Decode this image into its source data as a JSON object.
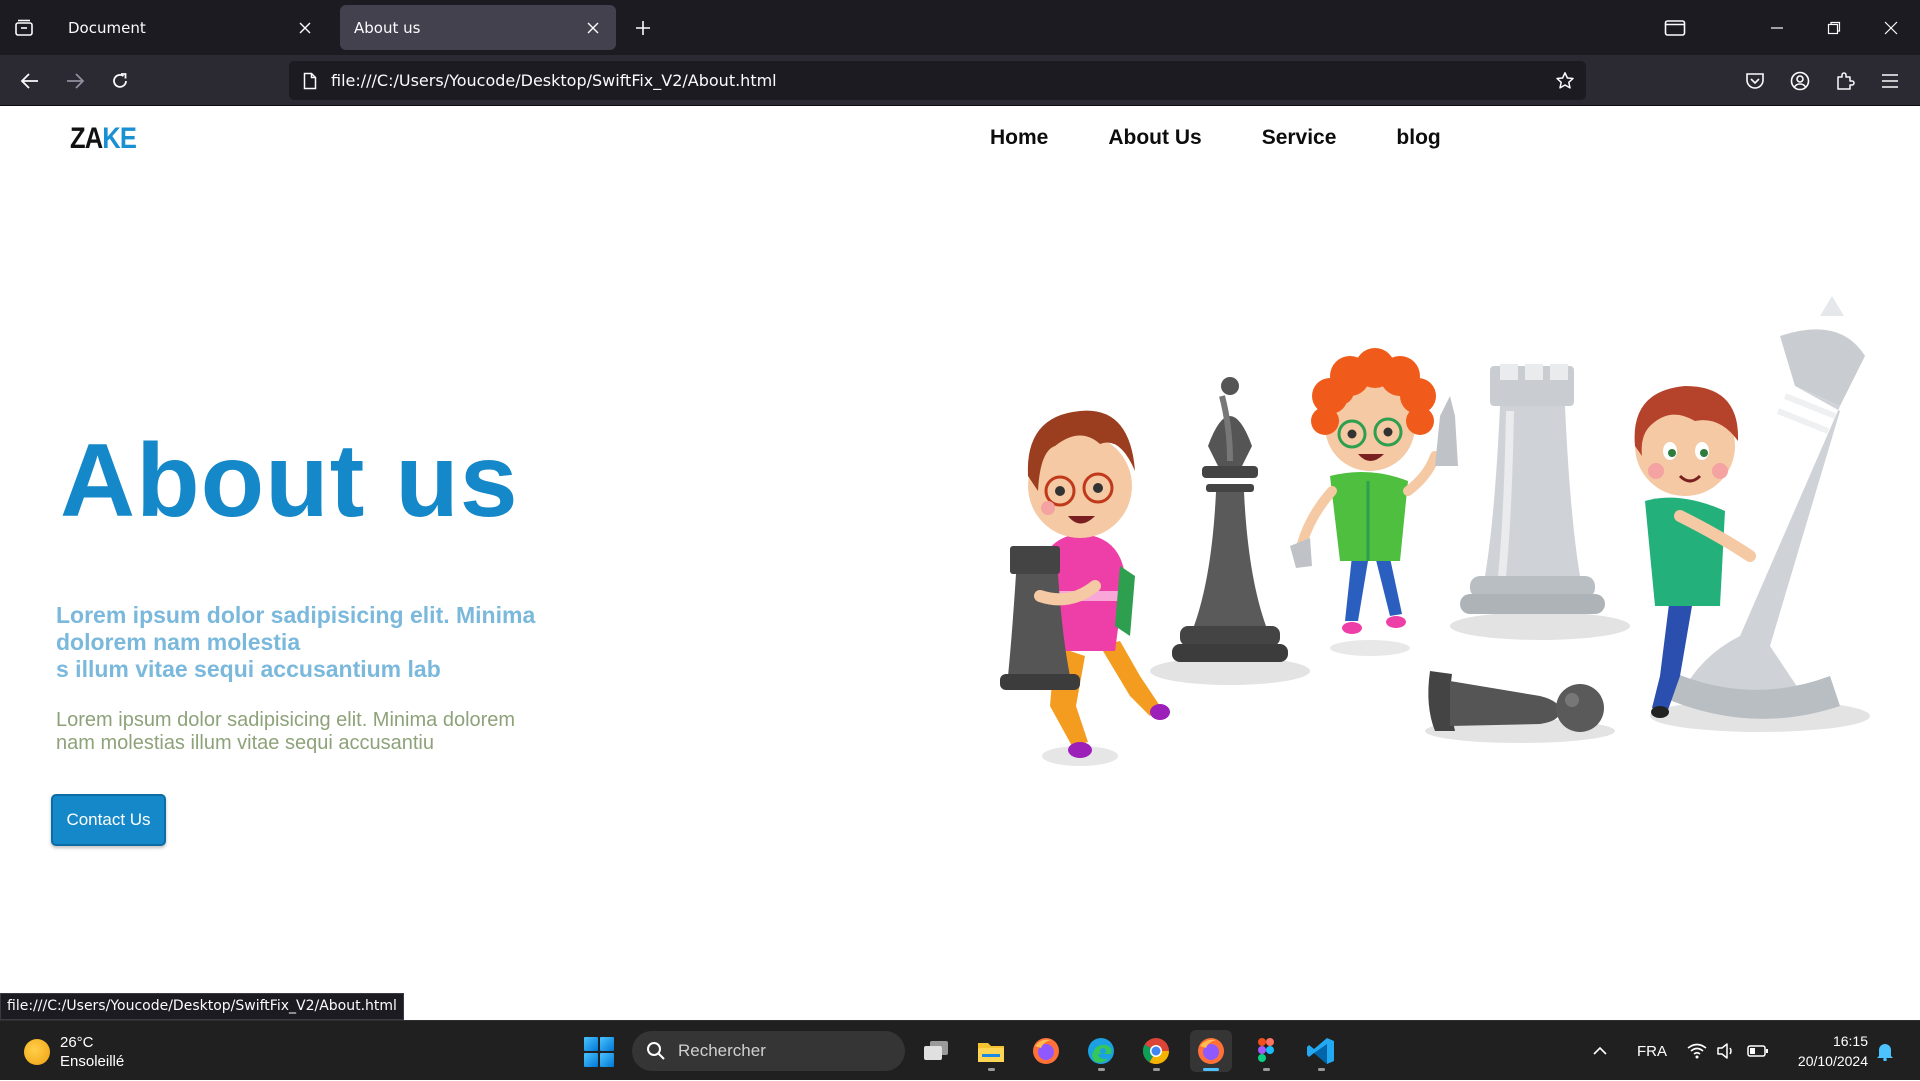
{
  "browser": {
    "tabs": [
      {
        "title": "Document"
      },
      {
        "title": "About us"
      }
    ],
    "url": "file:///C:/Users/Youcode/Desktop/SwiftFix_V2/About.html",
    "status_url": "file:///C:/Users/Youcode/Desktop/SwiftFix_V2/About.html"
  },
  "site": {
    "logo_left": "ZA",
    "logo_right": "KE",
    "nav": [
      "Home",
      "About Us",
      "Service",
      "blog"
    ],
    "hero": {
      "title": "About us",
      "subtitle_lines": [
        "Lorem ipsum dolor sadipisicing elit. Minima",
        "dolorem nam molestia",
        "s illum vitae sequi accusantium lab"
      ],
      "text_lines": [
        "Lorem ipsum dolor sadipisicing elit. Minima dolorem",
        "nam molestias illum vitae sequi accusantiu"
      ],
      "button": "Contact Us"
    },
    "colors": {
      "primary": "#1488c8",
      "subtitle": "#7ab8dc",
      "body_text": "#8ea27a"
    }
  },
  "taskbar": {
    "weather": {
      "temp": "26°C",
      "condition": "Ensoleillé"
    },
    "search_placeholder": "Rechercher",
    "apps": [
      "task-view-icon",
      "file-explorer-icon",
      "firefox-icon",
      "edge-icon",
      "chrome-icon",
      "firefox-dev-icon",
      "figma-icon",
      "vscode-icon"
    ],
    "language": "FRA",
    "time": "16:15",
    "date": "20/10/2024"
  }
}
